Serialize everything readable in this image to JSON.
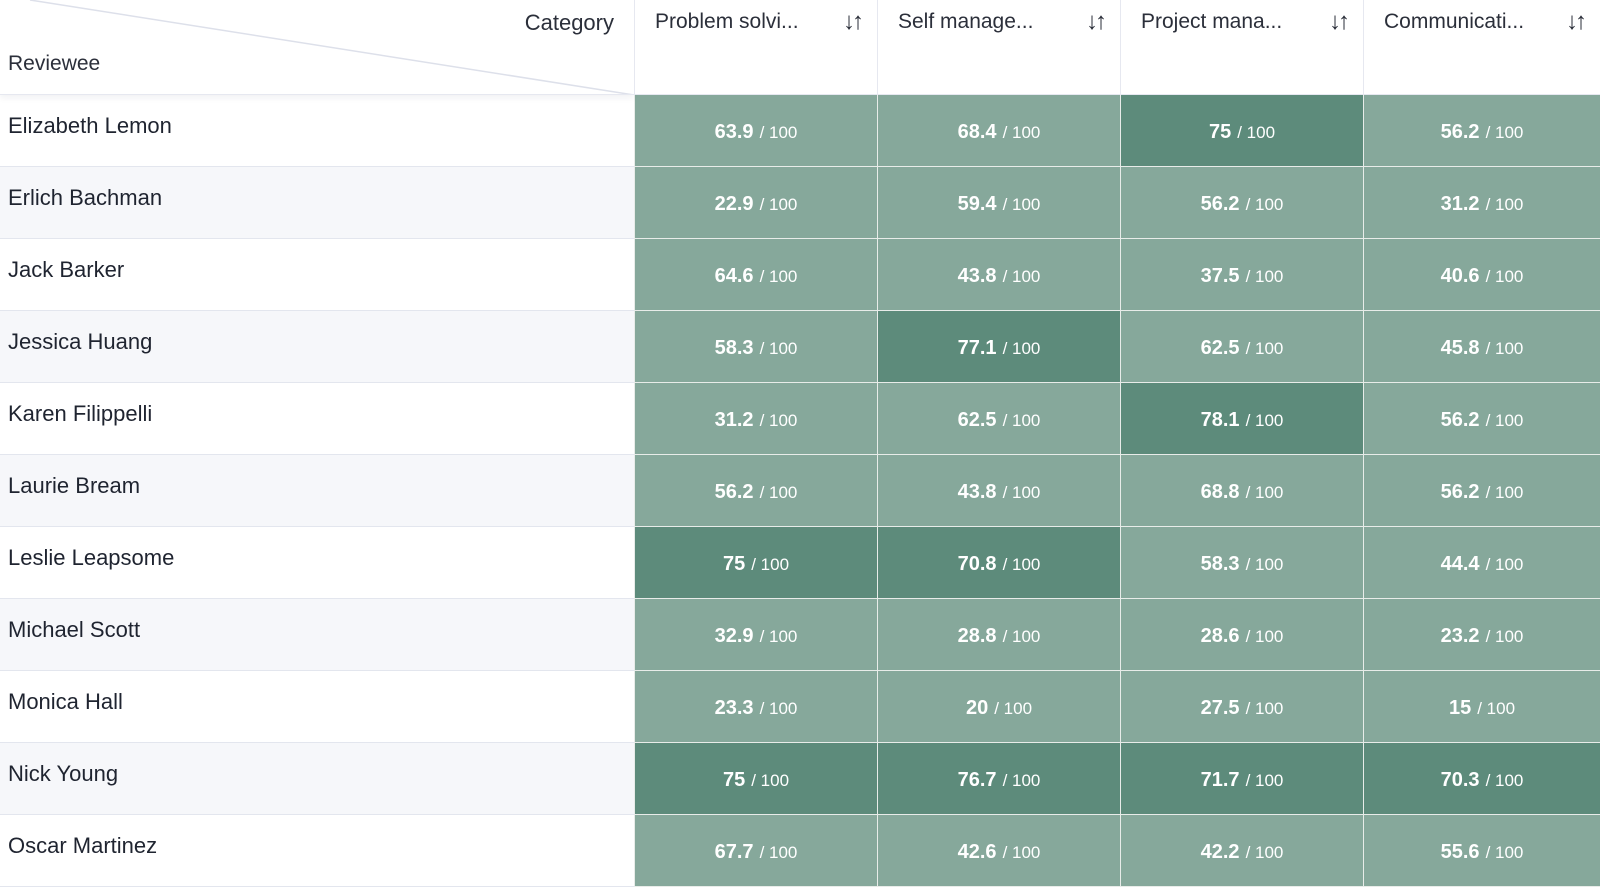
{
  "header": {
    "category_label": "Category",
    "reviewee_label": "Reviewee",
    "columns": [
      {
        "label": "Problem solvi...",
        "sort_icon": "sort-arrows-icon"
      },
      {
        "label": "Self manage...",
        "sort_icon": "sort-arrows-icon"
      },
      {
        "label": "Project mana...",
        "sort_icon": "sort-arrows-icon"
      },
      {
        "label": "Communicati...",
        "sort_icon": "sort-arrows-icon"
      }
    ]
  },
  "max_score": "/ 100",
  "colors": {
    "mid": "#86a89b",
    "high": "#5d8b7b"
  },
  "rows": [
    {
      "name": "Elizabeth Lemon",
      "scores": [
        "63.9",
        "68.4",
        "75",
        "56.2"
      ]
    },
    {
      "name": "Erlich Bachman",
      "scores": [
        "22.9",
        "59.4",
        "56.2",
        "31.2"
      ]
    },
    {
      "name": "Jack Barker",
      "scores": [
        "64.6",
        "43.8",
        "37.5",
        "40.6"
      ]
    },
    {
      "name": "Jessica Huang",
      "scores": [
        "58.3",
        "77.1",
        "62.5",
        "45.8"
      ]
    },
    {
      "name": "Karen Filippelli",
      "scores": [
        "31.2",
        "62.5",
        "78.1",
        "56.2"
      ]
    },
    {
      "name": "Laurie Bream",
      "scores": [
        "56.2",
        "43.8",
        "68.8",
        "56.2"
      ]
    },
    {
      "name": "Leslie Leapsome",
      "scores": [
        "75",
        "70.8",
        "58.3",
        "44.4"
      ]
    },
    {
      "name": "Michael Scott",
      "scores": [
        "32.9",
        "28.8",
        "28.6",
        "23.2"
      ]
    },
    {
      "name": "Monica Hall",
      "scores": [
        "23.3",
        "20",
        "27.5",
        "15"
      ]
    },
    {
      "name": "Nick Young",
      "scores": [
        "75",
        "76.7",
        "71.7",
        "70.3"
      ]
    },
    {
      "name": "Oscar Martinez",
      "scores": [
        "67.7",
        "42.6",
        "42.2",
        "55.6"
      ]
    }
  ]
}
